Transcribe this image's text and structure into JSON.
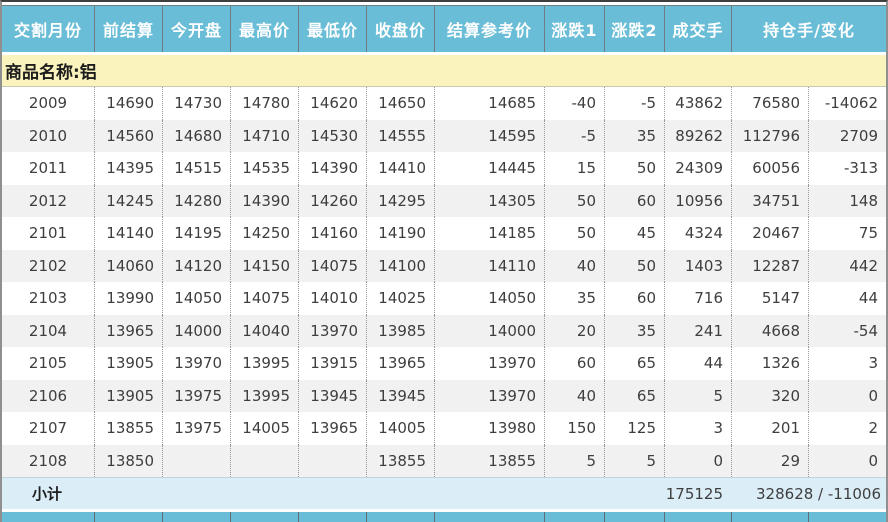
{
  "table": {
    "colors": {
      "header_bg": "#6ABDD6",
      "header_text": "#FFFFFF",
      "group_row_bg": "#FAF3BE",
      "row_bg": "#FFFFFF",
      "row_alt_bg": "#F1F1F1",
      "subtotal_bg": "#DBEDF7",
      "strip_bg": "#6ABDD6",
      "text": "#3E3E3E"
    },
    "headers": [
      {
        "key": "month",
        "label": "交割月份",
        "span": 1
      },
      {
        "key": "prev-settlement",
        "label": "前结算",
        "span": 1
      },
      {
        "key": "open",
        "label": "今开盘",
        "span": 1
      },
      {
        "key": "high",
        "label": "最高价",
        "span": 1
      },
      {
        "key": "low",
        "label": "最低价",
        "span": 1
      },
      {
        "key": "close",
        "label": "收盘价",
        "span": 1
      },
      {
        "key": "settlement-ref",
        "label": "结算参考价",
        "span": 1
      },
      {
        "key": "change1",
        "label": "涨跌1",
        "span": 1
      },
      {
        "key": "change2",
        "label": "涨跌2",
        "span": 1
      },
      {
        "key": "volume",
        "label": "成交手",
        "span": 1
      },
      {
        "key": "open-interest-change",
        "label": "持仓手/变化",
        "span": 2
      }
    ],
    "col_keys": [
      "month",
      "prev-settlement",
      "open",
      "high",
      "low",
      "close",
      "settlement-ref",
      "change1",
      "change2",
      "volume",
      "open-interest",
      "oi-change"
    ],
    "group_label": "商品名称:铝",
    "rows": [
      [
        "2009",
        "14690",
        "14730",
        "14780",
        "14620",
        "14650",
        "14685",
        "-40",
        "-5",
        "43862",
        "76580",
        "-14062"
      ],
      [
        "2010",
        "14560",
        "14680",
        "14710",
        "14530",
        "14555",
        "14595",
        "-5",
        "35",
        "89262",
        "112796",
        "2709"
      ],
      [
        "2011",
        "14395",
        "14515",
        "14535",
        "14390",
        "14410",
        "14445",
        "15",
        "50",
        "24309",
        "60056",
        "-313"
      ],
      [
        "2012",
        "14245",
        "14280",
        "14390",
        "14260",
        "14295",
        "14305",
        "50",
        "60",
        "10956",
        "34751",
        "148"
      ],
      [
        "2101",
        "14140",
        "14195",
        "14250",
        "14160",
        "14190",
        "14185",
        "50",
        "45",
        "4324",
        "20467",
        "75"
      ],
      [
        "2102",
        "14060",
        "14120",
        "14150",
        "14075",
        "14100",
        "14110",
        "40",
        "50",
        "1403",
        "12287",
        "442"
      ],
      [
        "2103",
        "13990",
        "14050",
        "14075",
        "14010",
        "14025",
        "14050",
        "35",
        "60",
        "716",
        "5147",
        "44"
      ],
      [
        "2104",
        "13965",
        "14000",
        "14040",
        "13970",
        "13985",
        "14000",
        "20",
        "35",
        "241",
        "4668",
        "-54"
      ],
      [
        "2105",
        "13905",
        "13970",
        "13995",
        "13915",
        "13965",
        "13970",
        "60",
        "65",
        "44",
        "1326",
        "3"
      ],
      [
        "2106",
        "13905",
        "13975",
        "13995",
        "13945",
        "13945",
        "13970",
        "40",
        "65",
        "5",
        "320",
        "0"
      ],
      [
        "2107",
        "13855",
        "13975",
        "14005",
        "13965",
        "14005",
        "13980",
        "150",
        "125",
        "3",
        "201",
        "2"
      ],
      [
        "2108",
        "13850",
        "",
        "",
        "",
        "13855",
        "13855",
        "5",
        "5",
        "0",
        "29",
        "0"
      ]
    ],
    "subtotal": {
      "label": "小计",
      "volume": "175125",
      "open_interest_change": "328628 / -11006"
    }
  }
}
